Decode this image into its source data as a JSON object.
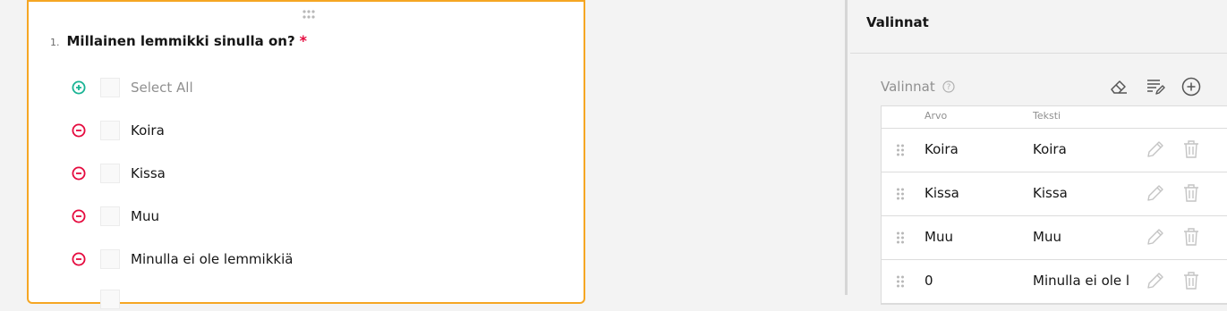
{
  "question": {
    "number": "1.",
    "title": "Millainen lemmikki sinulla on?",
    "required_mark": "*",
    "choices": [
      {
        "label": "Select All",
        "icon": "plus-circle-icon",
        "muted": true
      },
      {
        "label": "Koira",
        "icon": "minus-circle-icon"
      },
      {
        "label": "Kissa",
        "icon": "minus-circle-icon"
      },
      {
        "label": "Muu",
        "icon": "minus-circle-icon"
      },
      {
        "label": "Minulla ei ole lemmikkiä",
        "icon": "minus-circle-icon"
      }
    ]
  },
  "panel": {
    "title": "Valinnat",
    "section_label": "Valinnat",
    "columns": {
      "value": "Arvo",
      "text": "Teksti"
    },
    "rows": [
      {
        "value": "Koira",
        "text": "Koira"
      },
      {
        "value": "Kissa",
        "text": "Kissa"
      },
      {
        "value": "Muu",
        "text": "Muu"
      },
      {
        "value": "0",
        "text": "Minulla ei ole lemmikkiä"
      }
    ]
  },
  "colors": {
    "accent_orange": "#f5a623",
    "add_green": "#19b394",
    "remove_red": "#e50a3e",
    "muted_gray": "#909090"
  }
}
